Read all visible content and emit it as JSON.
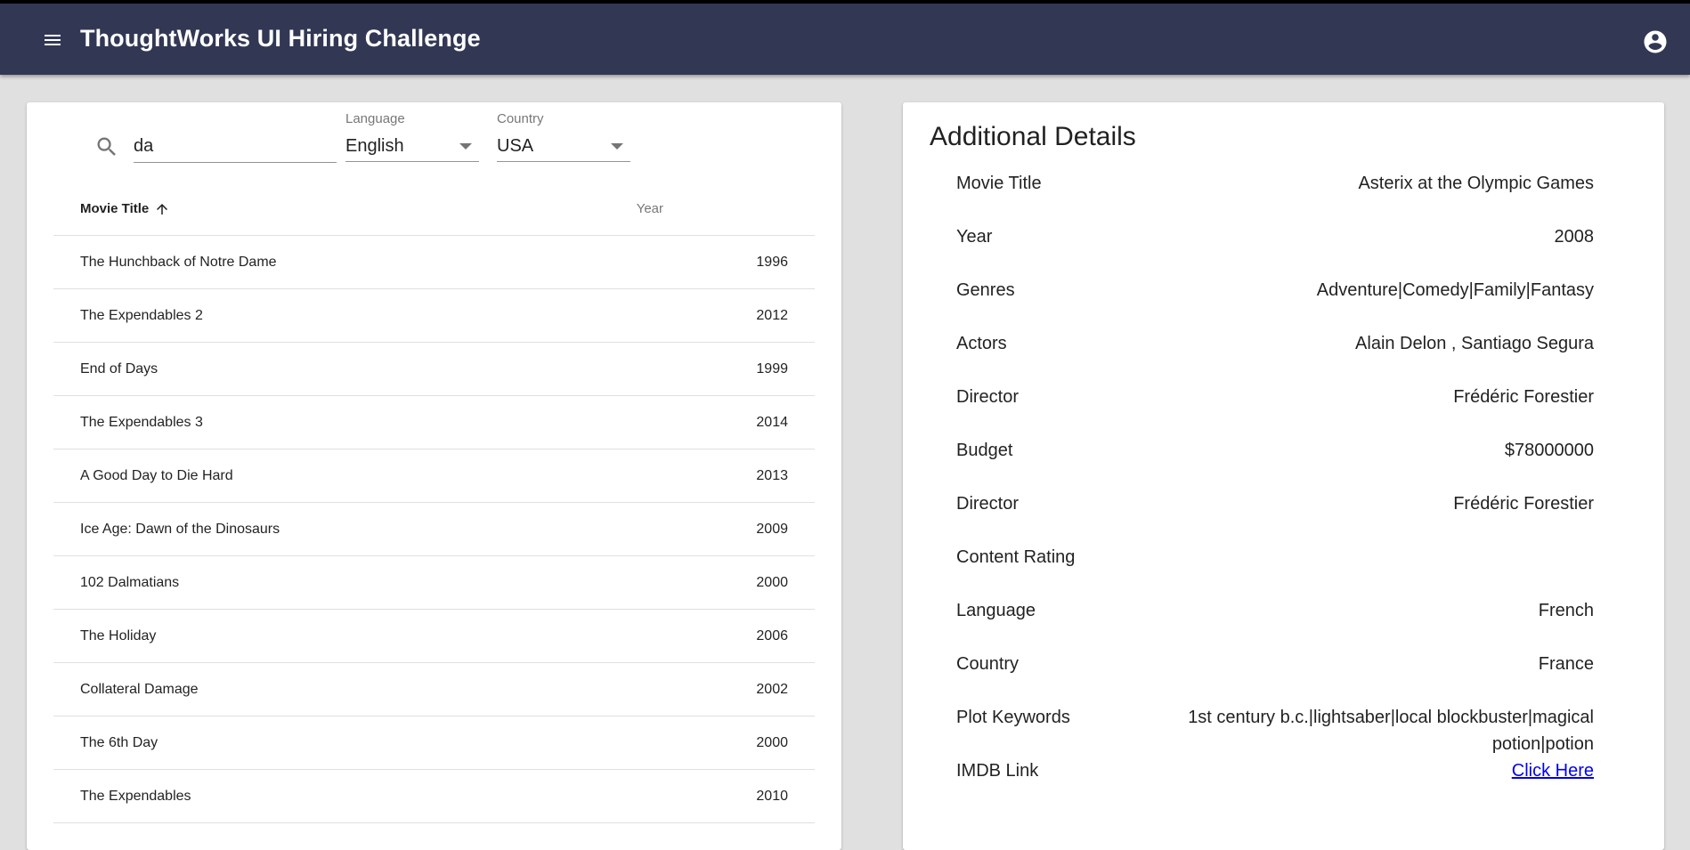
{
  "app": {
    "title": "ThoughtWorks UI Hiring Challenge"
  },
  "filters": {
    "search_value": "da",
    "language": {
      "label": "Language",
      "value": "English"
    },
    "country": {
      "label": "Country",
      "value": "USA"
    }
  },
  "table": {
    "headers": {
      "title": "Movie Title",
      "year": "Year"
    },
    "rows": [
      {
        "title": "The Hunchback of Notre Dame",
        "year": "1996"
      },
      {
        "title": "The Expendables 2",
        "year": "2012"
      },
      {
        "title": "End of Days",
        "year": "1999"
      },
      {
        "title": "The Expendables 3",
        "year": "2014"
      },
      {
        "title": "A Good Day to Die Hard",
        "year": "2013"
      },
      {
        "title": "Ice Age: Dawn of the Dinosaurs",
        "year": "2009"
      },
      {
        "title": "102 Dalmatians",
        "year": "2000"
      },
      {
        "title": "The Holiday",
        "year": "2006"
      },
      {
        "title": "Collateral Damage",
        "year": "2002"
      },
      {
        "title": "The 6th Day",
        "year": "2000"
      },
      {
        "title": "The Expendables",
        "year": "2010"
      }
    ]
  },
  "details": {
    "heading": "Additional Details",
    "rows": [
      {
        "label": "Movie Title",
        "value": "Asterix at the Olympic Games"
      },
      {
        "label": "Year",
        "value": "2008"
      },
      {
        "label": "Genres",
        "value": "Adventure|Comedy|Family|Fantasy"
      },
      {
        "label": "Actors",
        "value": "Alain Delon , Santiago Segura"
      },
      {
        "label": "Director",
        "value": "Frédéric Forestier"
      },
      {
        "label": "Budget",
        "value": "$78000000"
      },
      {
        "label": "Director",
        "value": "Frédéric Forestier"
      },
      {
        "label": "Content Rating",
        "value": ""
      },
      {
        "label": "Language",
        "value": "French"
      },
      {
        "label": "Country",
        "value": "France"
      },
      {
        "label": "Plot Keywords",
        "value": "1st century b.c.|lightsaber|local blockbuster|magical potion|potion"
      },
      {
        "label": "IMDB Link",
        "value": "Click Here"
      }
    ]
  },
  "icons": {
    "menu": "menu-icon",
    "account": "account-circle-icon",
    "search": "search-icon",
    "sort": "arrow-up-icon"
  },
  "colors": {
    "appbar": "#323754",
    "link": "#0000ee",
    "background": "#e0e0e0"
  }
}
